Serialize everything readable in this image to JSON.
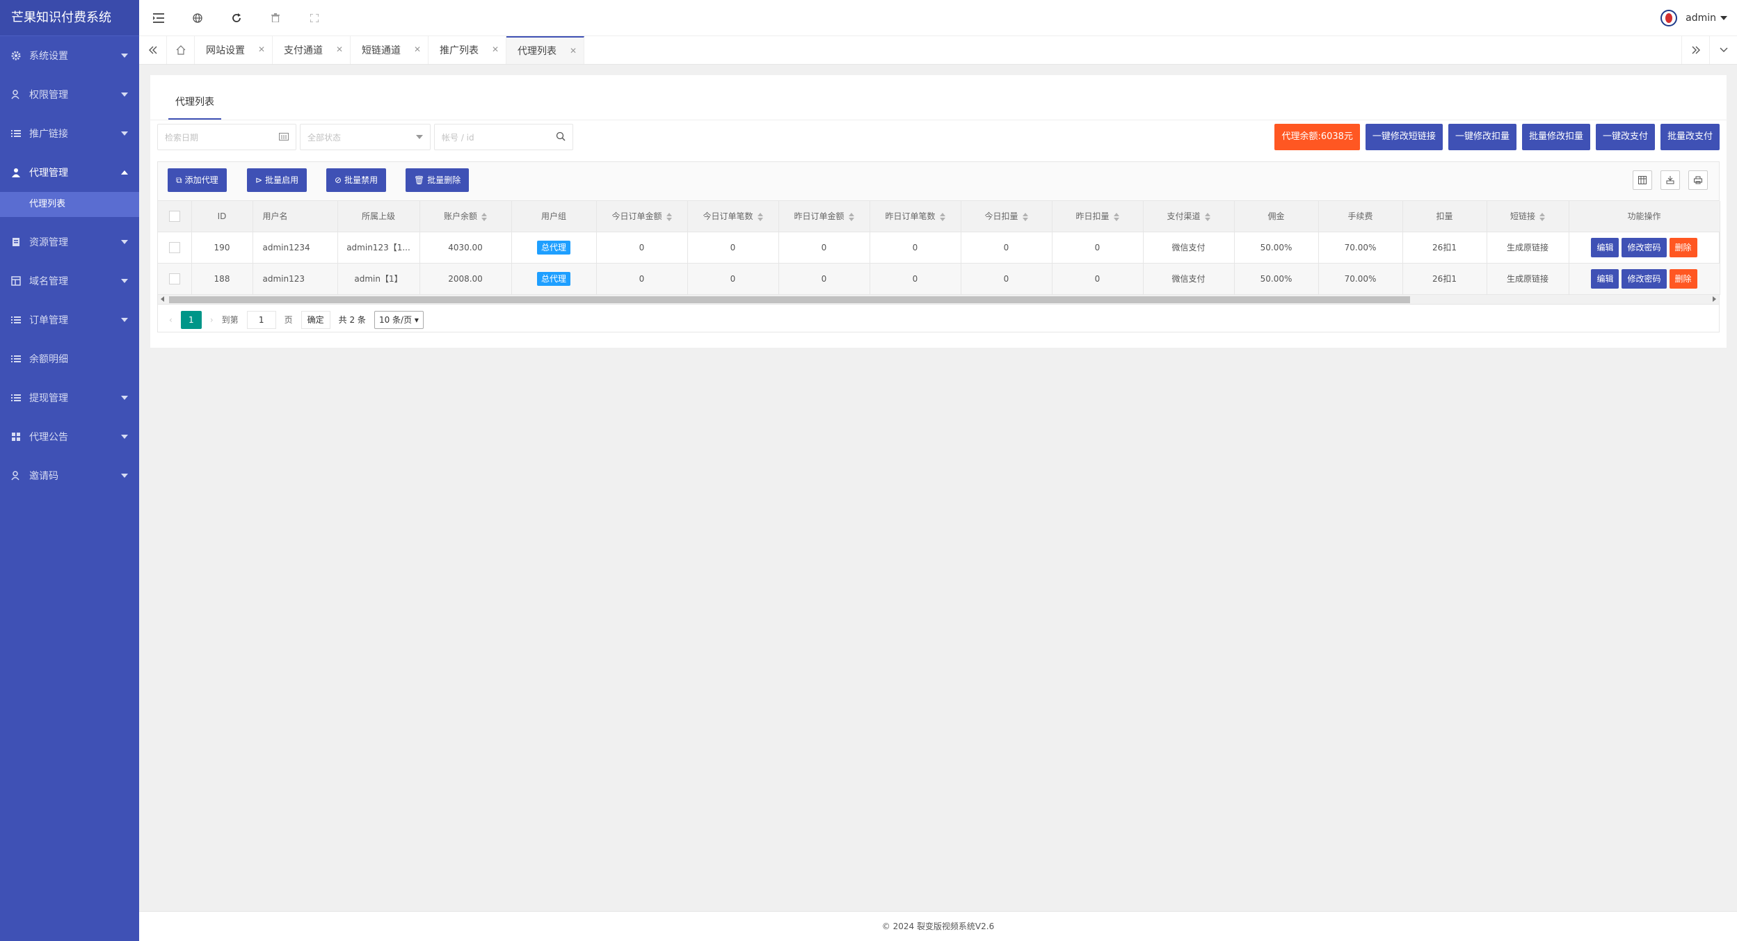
{
  "app": {
    "title": "芒果知识付费系统"
  },
  "sidebar": {
    "items": [
      {
        "label": "系统设置",
        "icon": "gear-icon"
      },
      {
        "label": "权限管理",
        "icon": "users-icon"
      },
      {
        "label": "推广链接",
        "icon": "list-icon"
      },
      {
        "label": "代理管理",
        "icon": "user-icon"
      },
      {
        "label": "资源管理",
        "icon": "file-icon"
      },
      {
        "label": "域名管理",
        "icon": "table-icon"
      },
      {
        "label": "订单管理",
        "icon": "list-icon"
      },
      {
        "label": "余额明细",
        "icon": "list-icon"
      },
      {
        "label": "提现管理",
        "icon": "list-icon"
      },
      {
        "label": "代理公告",
        "icon": "grid-icon"
      },
      {
        "label": "邀请码",
        "icon": "users-icon"
      }
    ],
    "active_sub": "代理列表"
  },
  "header": {
    "user": "admin"
  },
  "tabs": [
    "网站设置",
    "支付通道",
    "短链通道",
    "推广列表",
    "代理列表"
  ],
  "card": {
    "tab": "代理列表"
  },
  "filters": {
    "date": "检索日期",
    "status": "全部状态",
    "account": "帐号 / id"
  },
  "top_buttons": [
    "代理余额:6038元",
    "一键修改短链接",
    "一键修改扣量",
    "批量修改扣量",
    "一键改支付",
    "批量改支付"
  ],
  "actions": [
    "添加代理",
    "批量启用",
    "批量禁用",
    "批量删除"
  ],
  "table": {
    "headers": [
      "ID",
      "用户名",
      "所属上级",
      "账户余额",
      "用户组",
      "今日订单金额",
      "今日订单笔数",
      "昨日订单金额",
      "昨日订单笔数",
      "今日扣量",
      "昨日扣量",
      "支付渠道",
      "佣金",
      "手续费",
      "扣量",
      "短链接",
      "功能操作"
    ],
    "rows": [
      [
        "190",
        "admin1234",
        "admin123【1...",
        "4030.00",
        "总代理",
        "0",
        "0",
        "0",
        "0",
        "0",
        "0",
        "微信支付",
        "50.00%",
        "70.00%",
        "26扣1",
        "生成原链接"
      ],
      [
        "188",
        "admin123",
        "admin【1】",
        "2008.00",
        "总代理",
        "0",
        "0",
        "0",
        "0",
        "0",
        "0",
        "微信支付",
        "50.00%",
        "70.00%",
        "26扣1",
        "生成原链接"
      ]
    ],
    "ops": [
      "编辑",
      "修改密码",
      "删除"
    ]
  },
  "pager": {
    "current": "1",
    "goto": "到第",
    "page_value": "1",
    "page": "页",
    "confirm": "确定",
    "total": "共 2 条",
    "size": "10 条/页"
  },
  "footer": "© 2024 裂变版视频系统V2.6",
  "colors": {
    "sidebar": "#3f51b5",
    "accent": "#3f51b5",
    "orange": "#ff5722",
    "tag": "#1e9fff",
    "page": "#009688"
  }
}
